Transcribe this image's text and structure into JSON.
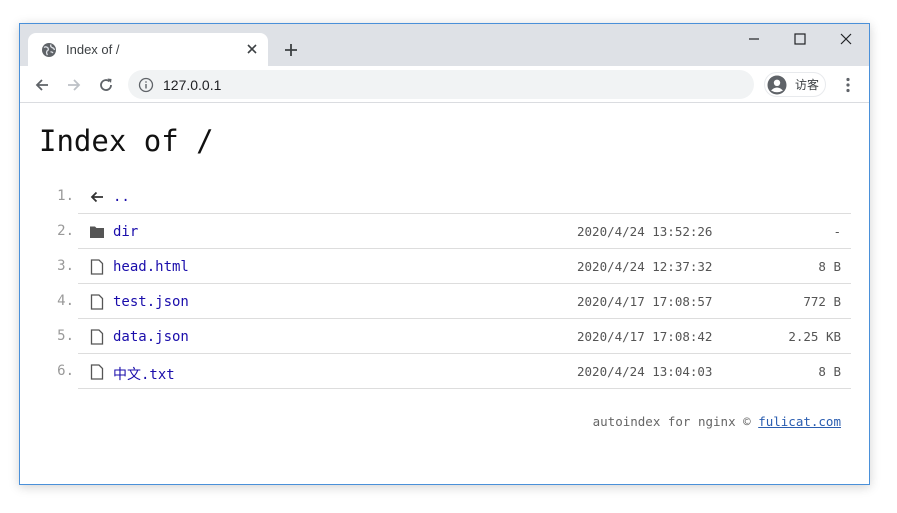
{
  "browser": {
    "tab_title": "Index of /",
    "url": "127.0.0.1",
    "profile_label": "访客"
  },
  "page": {
    "title": "Index of /",
    "rows": [
      {
        "num": "1.",
        "name": "..",
        "type": "parent",
        "mtime": "",
        "size": ""
      },
      {
        "num": "2.",
        "name": "dir",
        "type": "folder",
        "mtime": "2020/4/24 13:52:26",
        "size": "-"
      },
      {
        "num": "3.",
        "name": "head.html",
        "type": "file",
        "mtime": "2020/4/24 12:37:32",
        "size": "8 B"
      },
      {
        "num": "4.",
        "name": "test.json",
        "type": "file",
        "mtime": "2020/4/17 17:08:57",
        "size": "772 B"
      },
      {
        "num": "5.",
        "name": "data.json",
        "type": "file",
        "mtime": "2020/4/17 17:08:42",
        "size": "2.25 KB"
      },
      {
        "num": "6.",
        "name": "中文.txt",
        "type": "file",
        "mtime": "2020/4/24 13:04:03",
        "size": "8 B"
      }
    ],
    "footer_text": "autoindex for nginx ©",
    "footer_link": "fulicat.com"
  },
  "icons": {
    "tab": "globe-icon",
    "tab_close": "close-icon",
    "new_tab": "plus-icon",
    "minimize": "minimize-icon",
    "maximize": "maximize-icon",
    "close_window": "close-icon",
    "back": "arrow-left-icon",
    "forward": "arrow-right-icon",
    "reload": "reload-icon",
    "site_info": "info-icon",
    "profile": "person-icon",
    "menu": "more-vertical-icon",
    "parent": "arrow-left-icon",
    "folder": "folder-icon",
    "file": "file-icon"
  },
  "colors": {
    "titlebar": "#dee1e6",
    "link": "#1a0dab",
    "window_border": "#4a90d9"
  }
}
